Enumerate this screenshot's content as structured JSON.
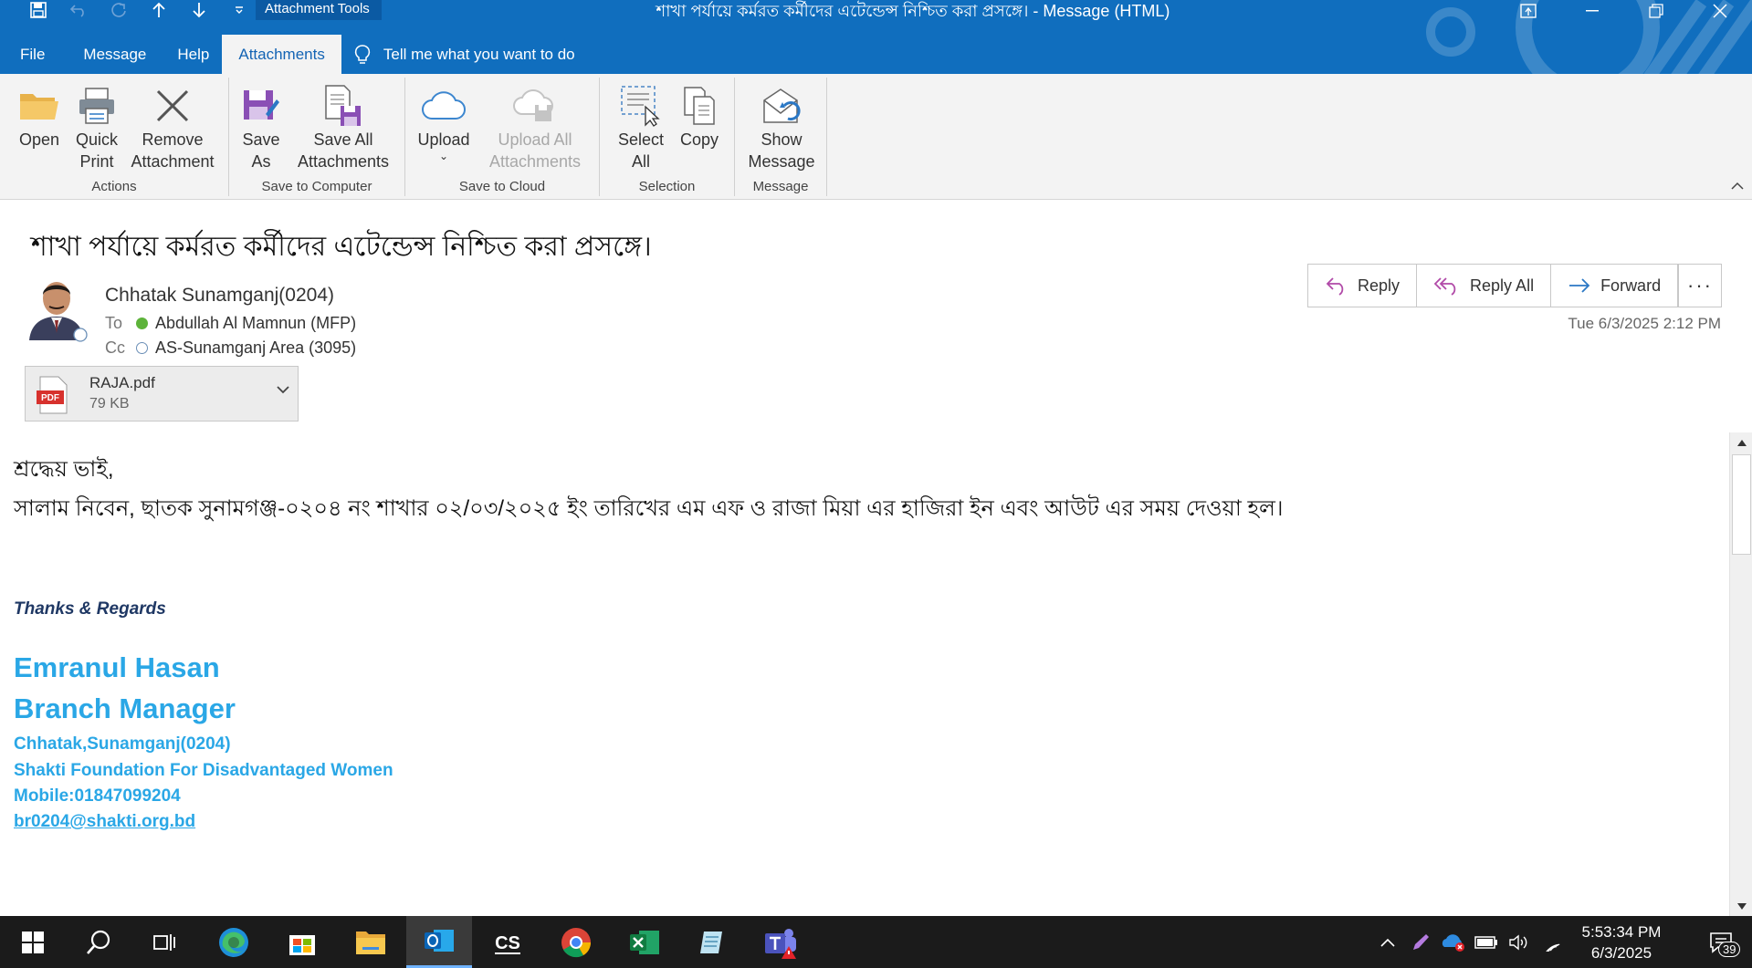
{
  "titlebar": {
    "context_tab": "Attachment Tools",
    "title": "শাখা পর্যায়ে কর্মরত কর্মীদের এটেন্ডেন্স নিশ্চিত করা প্রসঙ্গে।  -  Message (HTML)"
  },
  "tabs": [
    "File",
    "Message",
    "Help",
    "Attachments"
  ],
  "selected_tab": "Attachments",
  "tell_me": "Tell me what you want to do",
  "ribbon": {
    "actions": {
      "label": "Actions",
      "open": "Open",
      "quick_print_1": "Quick",
      "quick_print_2": "Print",
      "remove_1": "Remove",
      "remove_2": "Attachment"
    },
    "save_computer": {
      "label": "Save to Computer",
      "save_as_1": "Save",
      "save_as_2": "As",
      "save_all_1": "Save All",
      "save_all_2": "Attachments"
    },
    "save_cloud": {
      "label": "Save to Cloud",
      "upload": "Upload",
      "upload_all_1": "Upload All",
      "upload_all_2": "Attachments"
    },
    "selection": {
      "label": "Selection",
      "select_all_1": "Select",
      "select_all_2": "All",
      "copy": "Copy"
    },
    "message": {
      "label": "Message",
      "show_1": "Show",
      "show_2": "Message"
    }
  },
  "message": {
    "subject": "শাখা পর্যায়ে কর্মরত কর্মীদের এটেন্ডেন্স নিশ্চিত করা প্রসঙ্গে।",
    "sender": "Chhatak Sunamganj(0204)",
    "to_label": "To",
    "to": "Abdullah Al Mamnun (MFP)",
    "cc_label": "Cc",
    "cc": "AS-Sunamganj Area (3095)",
    "reply": "Reply",
    "reply_all": "Reply All",
    "forward": "Forward",
    "more": "···",
    "datetime": "Tue 6/3/2025 2:12 PM",
    "attachment": {
      "name": "RAJA.pdf",
      "size": "79 KB",
      "type_label": "PDF"
    }
  },
  "body": {
    "greeting": "শ্রদ্ধেয় ভাই,",
    "line1": "সালাম নিবেন, ছাতক সুনামগঞ্জ-০২০৪ নং শাখার ০২/০৩/২০২৫ ইং তারিখের এম এফ ও রাজা মিয়া এর হাজিরা ইন এবং আউট এর সময় দেওয়া হল।",
    "thanks": "Thanks & Regards",
    "sig_name": "Emranul Hasan",
    "sig_title": "Branch Manager",
    "sig_branch": "Chhatak,Sunamganj(0204)",
    "sig_org": "Shakti Foundation For Disadvantaged Women",
    "sig_mobile": "Mobile:01847099204",
    "sig_email": "br0204@shakti.org.bd"
  },
  "taskbar": {
    "time": "5:53:34 PM",
    "date": "6/3/2025",
    "notifications": "39"
  },
  "colors": {
    "title_blue": "#106ebe",
    "signature_blue": "#2aa7e6",
    "thanks_navy": "#1f3864"
  }
}
